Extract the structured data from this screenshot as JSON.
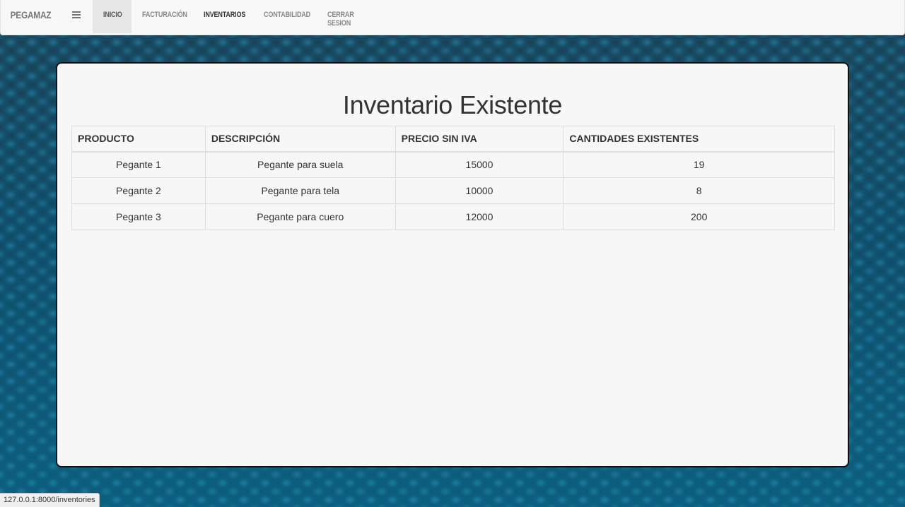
{
  "navbar": {
    "brand": "PEGAMAZ",
    "menu_icon": "hamburger-menu-icon",
    "items": [
      {
        "label": "INICIO",
        "active": true
      },
      {
        "label": "FACTURACIÓN"
      },
      {
        "label": "INVENTARIOS"
      },
      {
        "label": "CONTABILIDAD"
      },
      {
        "label": "CERRAR SESION"
      }
    ]
  },
  "main": {
    "title": "Inventario Existente",
    "table": {
      "headers": [
        "PRODUCTO",
        "DESCRIPCIÓN",
        "PRECIO SIN IVA",
        "CANTIDADES EXISTENTES"
      ],
      "rows": [
        [
          "Pegante 1",
          "Pegante para suela",
          "15000",
          "19"
        ],
        [
          "Pegante 2",
          "Pegante para tela",
          "10000",
          "8"
        ],
        [
          "Pegante 3",
          "Pegante para cuero",
          "12000",
          "200"
        ]
      ]
    }
  },
  "statusbar": {
    "url": "127.0.0.1:8000/inventories"
  },
  "colors": {
    "navbar_bg": "#f8f8f8",
    "active_nav_bg": "#e7e7e7",
    "panel_bg": "#f7f7f7",
    "panel_border": "#111111",
    "background": "#0e4a63"
  }
}
